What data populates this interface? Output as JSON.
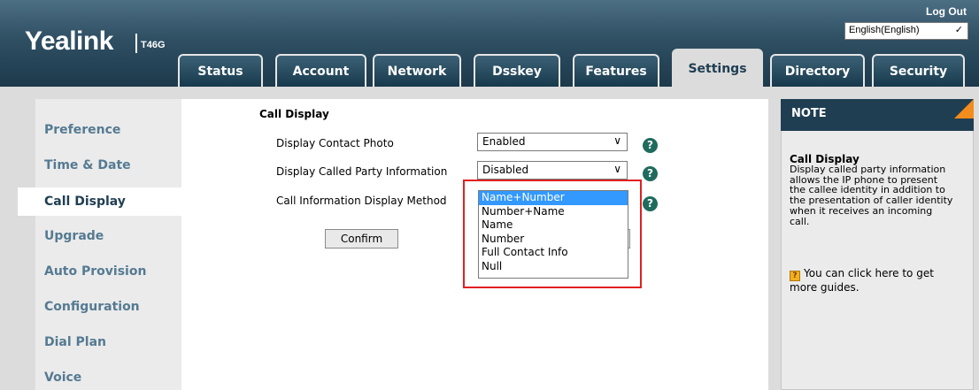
{
  "header": {
    "logo": "Yealink",
    "model": "T46G",
    "logout": "Log Out",
    "language": "English(English)"
  },
  "tabs": [
    {
      "label": "Status"
    },
    {
      "label": "Account"
    },
    {
      "label": "Network"
    },
    {
      "label": "Dsskey"
    },
    {
      "label": "Features"
    },
    {
      "label": "Settings"
    },
    {
      "label": "Directory"
    },
    {
      "label": "Security"
    }
  ],
  "active_tab": "Settings",
  "sidebar": {
    "items": [
      {
        "label": "Preference"
      },
      {
        "label": "Time & Date"
      },
      {
        "label": "Call Display"
      },
      {
        "label": "Upgrade"
      },
      {
        "label": "Auto Provision"
      },
      {
        "label": "Configuration"
      },
      {
        "label": "Dial Plan"
      },
      {
        "label": "Voice"
      }
    ],
    "active": "Call Display"
  },
  "main": {
    "section_title": "Call Display",
    "rows": [
      {
        "label": "Display Contact Photo",
        "value": "Enabled"
      },
      {
        "label": "Display Called Party Information",
        "value": "Disabled"
      },
      {
        "label": "Call Information Display Method",
        "value": "Name+Number"
      }
    ],
    "dropdown_options": [
      "Name+Number",
      "Number+Name",
      "Name",
      "Number",
      "Full Contact Info",
      "Null"
    ],
    "confirm_label": "Confirm",
    "help_glyph": "?"
  },
  "note": {
    "title": "NOTE",
    "heading": "Call Display",
    "body_lines": [
      "Display called party information",
      "allows the IP phone to present",
      "the callee identity in addition to",
      "the presentation of caller identity",
      "when it receives an incoming",
      "call."
    ],
    "guide_lines": [
      "You can click here to get",
      "more guides."
    ],
    "guide_icon_glyph": "?"
  },
  "colors": {
    "header_dark": "#1d3a4c",
    "nav_text": "#557a92",
    "highlight": "#e02020",
    "note_accent": "#f28c1c",
    "help_icon": "#1f6b5e"
  }
}
